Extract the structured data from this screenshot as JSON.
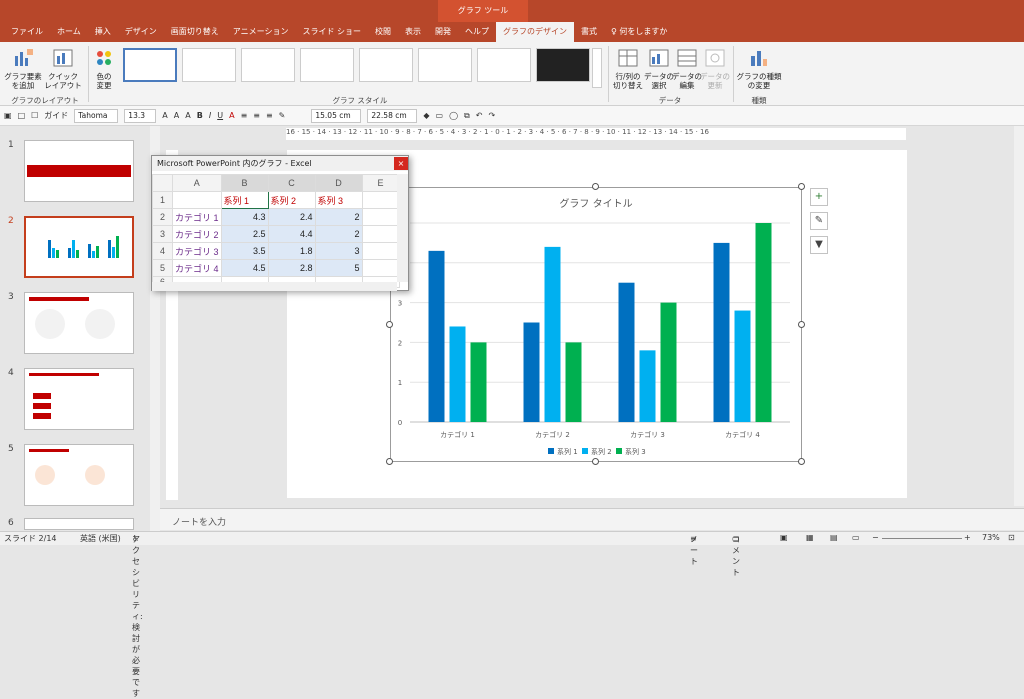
{
  "tool_tab": "グラフ ツール",
  "tabs": [
    "ファイル",
    "ホーム",
    "挿入",
    "デザイン",
    "画面切り替え",
    "アニメーション",
    "スライド ショー",
    "校閲",
    "表示",
    "開発",
    "ヘルプ",
    "グラフのデザイン",
    "書式",
    "何をしますか"
  ],
  "ribbon": {
    "add_element": "グラフ要素\nを追加",
    "quick_layout": "クイック\nレイアウト",
    "change_colors": "色の\n変更",
    "group_layout": "グラフのレイアウト",
    "group_style": "グラフ スタイル",
    "switch_row_col": "行/列の\n切り替え",
    "select_data": "データの\n選択",
    "edit_data": "データの\n編集",
    "refresh_data": "データの\n更新",
    "group_data": "データ",
    "change_type": "グラフの種類\nの変更",
    "group_type": "種類"
  },
  "format": {
    "font": "Tahoma",
    "size": "13.3",
    "gaido": "ガイド",
    "height": "15.05 cm",
    "width": "22.58 cm"
  },
  "ruler_text": "16 · 15 · 14 · 13 · 12 · 11 · 10 · 9 · 8 · 7 · 6 · 5 · 4 · 3 · 2 · 1 · 0 · 1 · 2 · 3 · 4 · 5 · 6 · 7 · 8 · 9 · 10 · 11 · 12 · 13 · 14 · 15 · 16",
  "slides": [
    "1",
    "2",
    "3",
    "4",
    "5",
    "6"
  ],
  "excel": {
    "title": "Microsoft PowerPoint 内のグラフ - Excel",
    "close": "×",
    "cols": [
      "A",
      "B",
      "C",
      "D",
      "E"
    ],
    "rows": [
      "1",
      "2",
      "3",
      "4",
      "5",
      "6"
    ],
    "header": [
      "",
      "系列 1",
      "系列 2",
      "系列 3",
      ""
    ],
    "data": [
      [
        "カテゴリ 1",
        "4.3",
        "2.4",
        "2"
      ],
      [
        "カテゴリ 2",
        "2.5",
        "4.4",
        "2"
      ],
      [
        "カテゴリ 3",
        "3.5",
        "1.8",
        "3"
      ],
      [
        "カテゴリ 4",
        "4.5",
        "2.8",
        "5"
      ]
    ]
  },
  "chart_data": {
    "type": "bar",
    "title": "グラフ タイトル",
    "categories": [
      "カテゴリ 1",
      "カテゴリ 2",
      "カテゴリ 3",
      "カテゴリ 4"
    ],
    "series": [
      {
        "name": "系列 1",
        "values": [
          4.3,
          2.5,
          3.5,
          4.5
        ],
        "color": "#0070c0"
      },
      {
        "name": "系列 2",
        "values": [
          2.4,
          4.4,
          1.8,
          2.8
        ],
        "color": "#00b0f0"
      },
      {
        "name": "系列 3",
        "values": [
          2,
          2,
          3,
          5
        ],
        "color": "#00b050"
      }
    ],
    "ylim": [
      0,
      5
    ],
    "y_ticks": [
      "0",
      "1",
      "2",
      "3"
    ],
    "legend": "bottom",
    "grid": true
  },
  "notes": "ノートを入力",
  "status": {
    "slide": "スライド 2/14",
    "lang": "英語 (米国)",
    "access": "アクセシビリティ: 検討が必要です",
    "notes": "ノート",
    "comments": "コメント",
    "zoom": "73%"
  }
}
